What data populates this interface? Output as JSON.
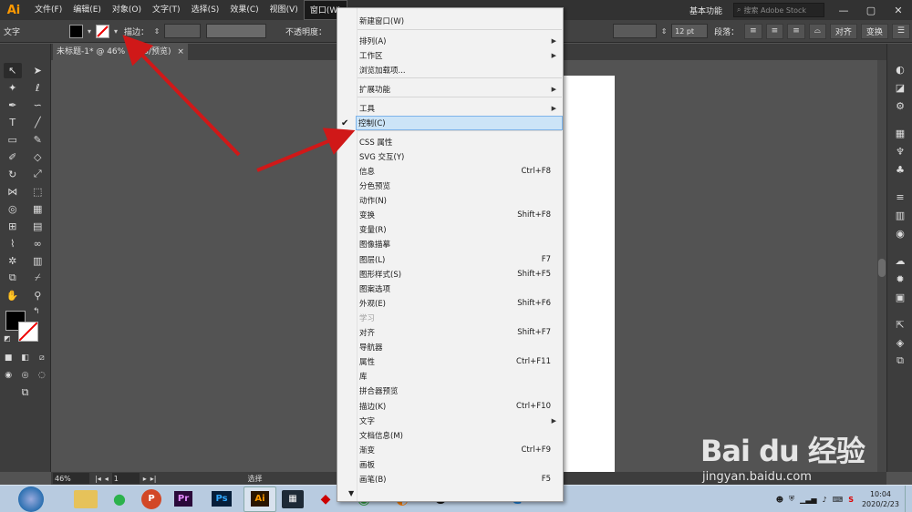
{
  "app": {
    "logo": "Ai"
  },
  "menubar": {
    "items": [
      "文件(F)",
      "编辑(E)",
      "对象(O)",
      "文字(T)",
      "选择(S)",
      "效果(C)",
      "视图(V)",
      "窗口(W)"
    ],
    "active_index": 7,
    "workspace": "基本功能",
    "search_placeholder": "搜索 Adobe Stock",
    "window_controls": [
      "—",
      "▢",
      "✕"
    ]
  },
  "controlbar": {
    "type_label": "文字",
    "stroke_label": "描边：",
    "opacity_label": "不透明度：",
    "font_size": "12 pt",
    "paragraph_label": "段落：",
    "align_label": "对齐",
    "transform_label": "变换"
  },
  "document_tab": {
    "title": "未标题-1* @ 46% (RGB/预览)",
    "close": "×"
  },
  "statusbar": {
    "zoom": "46%",
    "page": "1",
    "tool_name": "选择"
  },
  "window_menu": {
    "items": [
      {
        "label": "新建窗口(W)",
        "shortcut": "",
        "submenu": false
      },
      {
        "label": "排列(A)",
        "shortcut": "",
        "submenu": true
      },
      {
        "label": "工作区",
        "shortcut": "",
        "submenu": true
      },
      {
        "label": "浏览加载项...",
        "shortcut": "",
        "submenu": false
      },
      {
        "label": "扩展功能",
        "shortcut": "",
        "submenu": true
      },
      {
        "label": "工具",
        "shortcut": "",
        "submenu": true
      },
      {
        "label": "控制(C)",
        "shortcut": "",
        "submenu": false,
        "checked": true,
        "highlighted": true
      },
      {
        "label": "CSS 属性",
        "shortcut": "",
        "submenu": false
      },
      {
        "label": "SVG 交互(Y)",
        "shortcut": "",
        "submenu": false
      },
      {
        "label": "信息",
        "shortcut": "Ctrl+F8",
        "submenu": false
      },
      {
        "label": "分色预览",
        "shortcut": "",
        "submenu": false
      },
      {
        "label": "动作(N)",
        "shortcut": "",
        "submenu": false
      },
      {
        "label": "变换",
        "shortcut": "Shift+F8",
        "submenu": false
      },
      {
        "label": "变量(R)",
        "shortcut": "",
        "submenu": false
      },
      {
        "label": "图像描摹",
        "shortcut": "",
        "submenu": false
      },
      {
        "label": "图层(L)",
        "shortcut": "F7",
        "submenu": false
      },
      {
        "label": "图形样式(S)",
        "shortcut": "Shift+F5",
        "submenu": false
      },
      {
        "label": "图案选项",
        "shortcut": "",
        "submenu": false
      },
      {
        "label": "外观(E)",
        "shortcut": "Shift+F6",
        "submenu": false
      },
      {
        "label": "学习",
        "shortcut": "",
        "submenu": false,
        "disabled": true
      },
      {
        "label": "对齐",
        "shortcut": "Shift+F7",
        "submenu": false
      },
      {
        "label": "导航器",
        "shortcut": "",
        "submenu": false
      },
      {
        "label": "属性",
        "shortcut": "Ctrl+F11",
        "submenu": false
      },
      {
        "label": "库",
        "shortcut": "",
        "submenu": false
      },
      {
        "label": "拼合器预览",
        "shortcut": "",
        "submenu": false
      },
      {
        "label": "描边(K)",
        "shortcut": "Ctrl+F10",
        "submenu": false
      },
      {
        "label": "文字",
        "shortcut": "",
        "submenu": true
      },
      {
        "label": "文档信息(M)",
        "shortcut": "",
        "submenu": false
      },
      {
        "label": "渐变",
        "shortcut": "Ctrl+F9",
        "submenu": false
      },
      {
        "label": "画板",
        "shortcut": "",
        "submenu": false
      },
      {
        "label": "画笔(B)",
        "shortcut": "F5",
        "submenu": false
      }
    ]
  },
  "taskbar": {
    "apps": [
      "Pr",
      "Ps",
      "Ai"
    ],
    "clock_time": "10:04",
    "clock_date": "2020/2/23"
  },
  "watermark": {
    "brand": "Bai du 经验",
    "url": "jingyan.baidu.com"
  }
}
